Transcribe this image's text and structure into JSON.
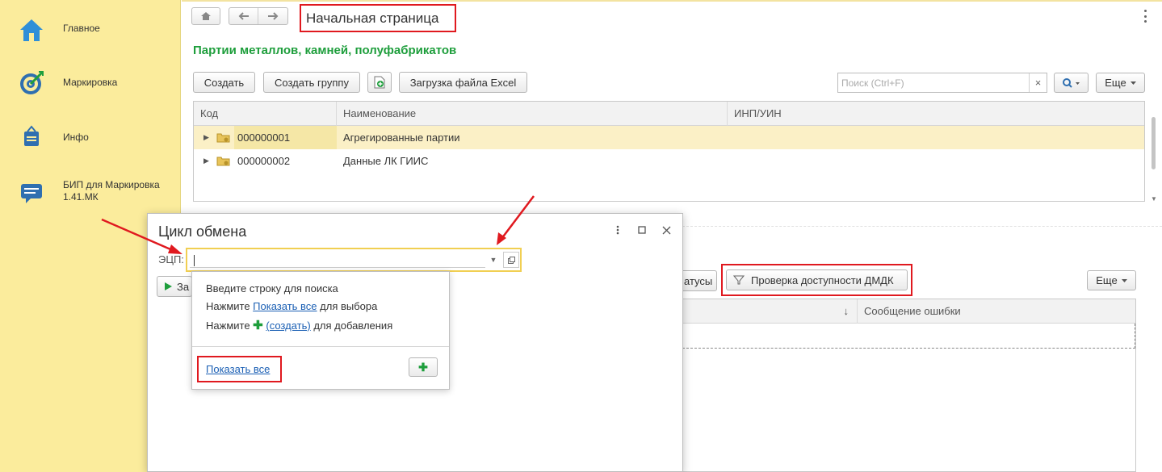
{
  "sidebar": {
    "items": [
      {
        "label": "Главное",
        "icon": "home-icon"
      },
      {
        "label": "Маркировка",
        "icon": "target-icon"
      },
      {
        "label": "Инфо",
        "icon": "bag-icon"
      },
      {
        "label": "БИП для Маркировка 1.41.МК",
        "icon": "chat-icon"
      }
    ]
  },
  "header": {
    "title": "Начальная страница"
  },
  "section": {
    "title": "Партии металлов, камней, полуфабрикатов"
  },
  "toolbar": {
    "create": "Создать",
    "create_group": "Создать группу",
    "upload_excel": "Загрузка файла Excel",
    "search_placeholder": "Поиск (Ctrl+F)",
    "search_clear": "×",
    "more": "Еще"
  },
  "table": {
    "columns": [
      "Код",
      "Наименование",
      "ИНП/УИН"
    ],
    "rows": [
      {
        "code": "000000001",
        "name": "Агрегированные партии",
        "inp": ""
      },
      {
        "code": "000000002",
        "name": "Данные ЛК ГИИС",
        "inp": ""
      }
    ]
  },
  "lower": {
    "statuses_partial": "атусы",
    "check_button": "Проверка доступности ДМДК",
    "more": "Еще",
    "sort_arrow": "↓",
    "error_column": "Сообщение ошибки",
    "start_partial": "За"
  },
  "dialog": {
    "title": "Цикл обмена",
    "field_label": "ЭЦП:",
    "dropdown": {
      "line1": "Введите строку для поиска",
      "line2_prefix": "Нажмите ",
      "line2_link": "Показать все",
      "line2_suffix": " для выбора",
      "line3_prefix": "Нажмите ",
      "line3_link": "(создать)",
      "line3_suffix": " для добавления",
      "show_all": "Показать все"
    }
  },
  "colors": {
    "sidebar_bg": "#fbec9c",
    "accent_green": "#1e9e3c",
    "highlight_red": "#e0191f",
    "focus_yellow": "#f1cf52",
    "link_blue": "#1a5fb4"
  }
}
